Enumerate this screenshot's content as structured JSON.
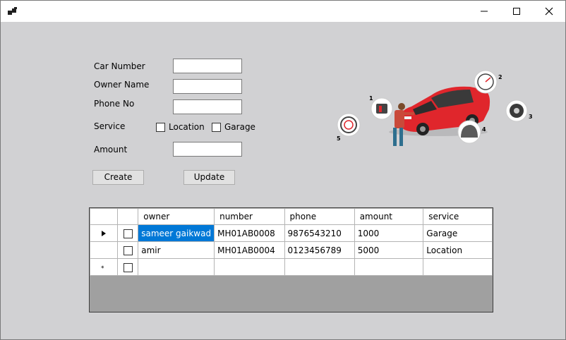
{
  "window": {
    "title": "",
    "controls": [
      "minimize",
      "maximize",
      "close"
    ]
  },
  "form": {
    "car_number_label": "Car Number",
    "owner_name_label": "Owner Name",
    "phone_no_label": "Phone No",
    "service_label": "Service",
    "amount_label": "Amount",
    "car_number_value": "",
    "owner_name_value": "",
    "phone_no_value": "",
    "amount_value": "",
    "location_label": "Location",
    "garage_label": "Garage",
    "location_checked": false,
    "garage_checked": false,
    "create_label": "Create",
    "update_label": "Update"
  },
  "illustration": {
    "callouts": [
      "1",
      "2",
      "3",
      "4",
      "5"
    ],
    "car_color": "#e0262c"
  },
  "grid": {
    "columns": [
      "",
      "owner",
      "number",
      "phone",
      "amount",
      "service"
    ],
    "rows": [
      {
        "marker": "current",
        "checked": false,
        "owner": "sameer gaikwad",
        "number": "MH01AB0008",
        "phone": "9876543210",
        "amount": "1000",
        "service": "Garage"
      },
      {
        "marker": "",
        "checked": false,
        "owner": "amir",
        "number": "MH01AB0004",
        "phone": "0123456789",
        "amount": "5000",
        "service": "Location"
      },
      {
        "marker": "new",
        "checked": false,
        "owner": "",
        "number": "",
        "phone": "",
        "amount": "",
        "service": ""
      }
    ],
    "selection_color": "#0078d7"
  }
}
